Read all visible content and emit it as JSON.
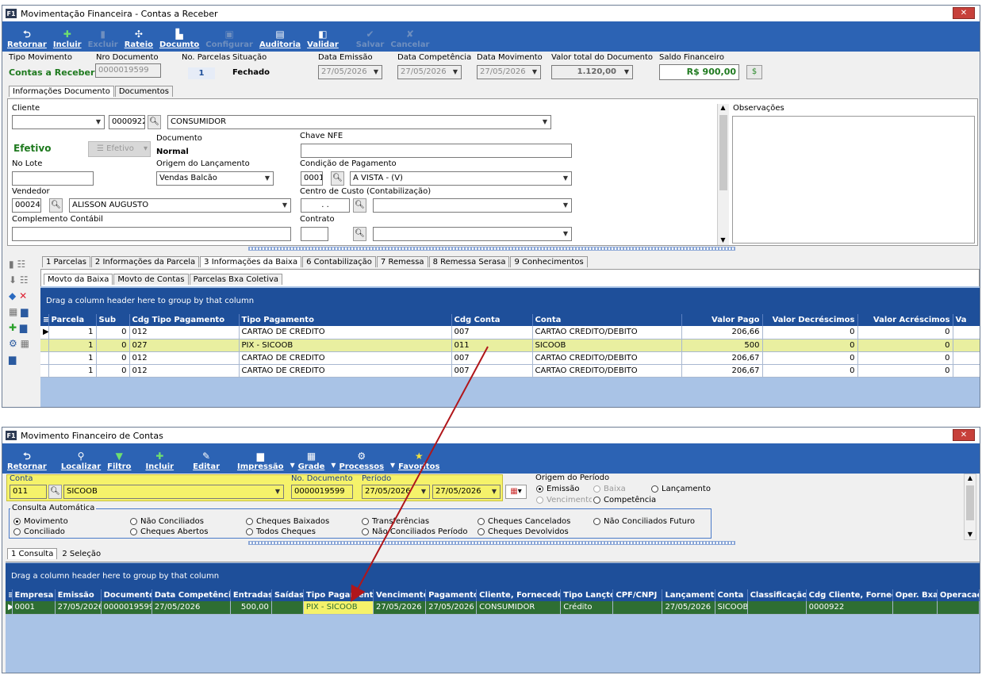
{
  "w1": {
    "title": "Movimentação Financeira - Contas a Receber",
    "toolbar": [
      {
        "label": "Retornar",
        "icon": "return-icon",
        "enabled": true
      },
      {
        "label": "Incluir",
        "icon": "plus-icon",
        "enabled": true
      },
      {
        "label": "Excluir",
        "icon": "trash-icon",
        "enabled": false
      },
      {
        "label": "Rateio",
        "icon": "split-icon",
        "enabled": true
      },
      {
        "label": "Documto",
        "icon": "document-icon",
        "enabled": true
      },
      {
        "label": "Configurar",
        "icon": "config-icon",
        "enabled": false
      },
      {
        "label": "Auditoria",
        "icon": "audit-icon",
        "enabled": true
      },
      {
        "label": "Validar",
        "icon": "validate-icon",
        "enabled": true
      },
      {
        "label": "Salvar",
        "icon": "check-icon",
        "enabled": false
      },
      {
        "label": "Cancelar",
        "icon": "cancel-icon",
        "enabled": false
      }
    ],
    "hdr": {
      "tipo_lbl": "Tipo Movimento",
      "tipo_val": "Contas a Receber",
      "nro_lbl": "Nro Documento",
      "nro_val": "0000019599",
      "parc_lbl": "No. Parcelas",
      "parc_val": "1",
      "sit_lbl": "Situação",
      "sit_val": "Fechado",
      "emis_lbl": "Data Emissão",
      "emis_val": "27/05/2026",
      "comp_lbl": "Data Competência",
      "comp_val": "27/05/2026",
      "mov_lbl": "Data Movimento",
      "mov_val": "27/05/2026",
      "vt_lbl": "Valor total do Documento",
      "vt_val": "1.120,00",
      "saldo_lbl": "Saldo Financeiro",
      "saldo_val": "R$ 900,00"
    },
    "tabs": [
      "Informações Documento",
      "Documentos"
    ],
    "form": {
      "cliente_lbl": "Cliente",
      "cliente_code": "0000922",
      "cliente_name": "CONSUMIDOR",
      "efetivo": "Efetivo",
      "efetivo_btn": "Efetivo",
      "doc_lbl": "Documento",
      "doc_val": "Normal",
      "chave_lbl": "Chave NFE",
      "lote_lbl": "No Lote",
      "origem_lbl": "Origem do Lançamento",
      "origem_val": "Vendas Balcão",
      "cond_lbl": "Condição de Pagamento",
      "cond_code": "0001",
      "cond_val": "A VISTA - (V)",
      "vend_lbl": "Vendedor",
      "vend_code": "00024",
      "vend_name": "ALISSON AUGUSTO",
      "cc_lbl": "Centro de Custo (Contabilização)",
      "cc_code": ". .",
      "compl_lbl": "Complemento Contábil",
      "contrato_lbl": "Contrato",
      "obs_lbl": "Observações"
    },
    "subtabs": [
      "1 Parcelas",
      "2 Informações da Parcela",
      "3 Informações da Baixa",
      "6 Contabilização",
      "7 Remessa",
      "8 Remessa Serasa",
      "9 Conhecimentos"
    ],
    "subtabs2": [
      "Movto da Baixa",
      "Movto de Contas",
      "Parcelas Bxa Coletiva"
    ],
    "group_hint": "Drag a column header here to group by that column",
    "cols": [
      "Parcela",
      "Sub",
      "Cdg Tipo Pagamento",
      "Tipo Pagamento",
      "Cdg Conta",
      "Conta",
      "Valor Pago",
      "Valor Decréscimos",
      "Valor Acréscimos",
      "Va"
    ],
    "rows": [
      [
        "1",
        "0",
        "012",
        "CARTAO DE CREDITO",
        "007",
        "CARTAO CREDITO/DEBITO",
        "206,66",
        "0",
        "0",
        ""
      ],
      [
        "1",
        "0",
        "027",
        "PIX - SICOOB",
        "011",
        "SICOOB",
        "500",
        "0",
        "0",
        ""
      ],
      [
        "1",
        "0",
        "012",
        "CARTAO DE CREDITO",
        "007",
        "CARTAO CREDITO/DEBITO",
        "206,67",
        "0",
        "0",
        ""
      ],
      [
        "1",
        "0",
        "012",
        "CARTAO DE CREDITO",
        "007",
        "CARTAO CREDITO/DEBITO",
        "206,67",
        "0",
        "0",
        ""
      ]
    ]
  },
  "w2": {
    "title": "Movimento Financeiro de Contas",
    "toolbar": [
      {
        "label": "Retornar",
        "icon": "return-icon"
      },
      {
        "label": "Localizar",
        "icon": "search-icon"
      },
      {
        "label": "Filtro",
        "icon": "filter-icon"
      },
      {
        "label": "Incluir",
        "icon": "plus-icon"
      },
      {
        "label": "Editar",
        "icon": "edit-icon"
      },
      {
        "label": "Impressão",
        "icon": "print-icon"
      },
      {
        "label": "Grade",
        "icon": "grid-icon"
      },
      {
        "label": "Processos",
        "icon": "gear-icon"
      },
      {
        "label": "Favoritos",
        "icon": "star-icon"
      }
    ],
    "filt": {
      "conta_lbl": "Conta",
      "conta_code": "011",
      "conta_name": "SICOOB",
      "nodoc_lbl": "No. Documento",
      "nodoc_val": "0000019599",
      "periodo_lbl": "Período",
      "d1": "27/05/2026",
      "d2": "27/05/2026",
      "origem_lbl": "Origem do Período",
      "r_emissao": "Emissão",
      "r_baixa": "Baixa",
      "r_lanc": "Lançamento",
      "r_venc": "Vencimento",
      "r_comp": "Competência"
    },
    "consulta_lbl": "Consulta Automática",
    "opts": [
      "Movimento",
      "Não Conciliados",
      "Cheques Baixados",
      "Transferências",
      "Cheques Cancelados",
      "Não Conciliados Futuro",
      "Conciliado",
      "Cheques Abertos",
      "Todos Cheques",
      "Não Conciliados Período",
      "Cheques Devolvidos"
    ],
    "tabs": [
      "1 Consulta",
      "2 Seleção"
    ],
    "group_hint": "Drag a column header here to group by that column",
    "cols": [
      "Empresa",
      "Emissão",
      "Documento",
      "Data Competência",
      "Entradas",
      "Saídas",
      "Tipo Pagamento",
      "Vencimento",
      "Pagamento",
      "Cliente, Fornecedor",
      "Tipo Lançto",
      "CPF/CNPJ",
      "Lançamento",
      "Conta",
      "Classificação",
      "Cdg Cliente, Fornec.",
      "Oper. Bxa",
      "Operacao"
    ],
    "row": [
      "0001",
      "27/05/2026",
      "0000019599",
      "27/05/2026",
      "500,00",
      "",
      "PIX - SICOOB",
      "27/05/2026",
      "27/05/2026",
      "CONSUMIDOR",
      "Crédito",
      "",
      "27/05/2026",
      "SICOOB",
      "",
      "0000922",
      "",
      ""
    ]
  }
}
